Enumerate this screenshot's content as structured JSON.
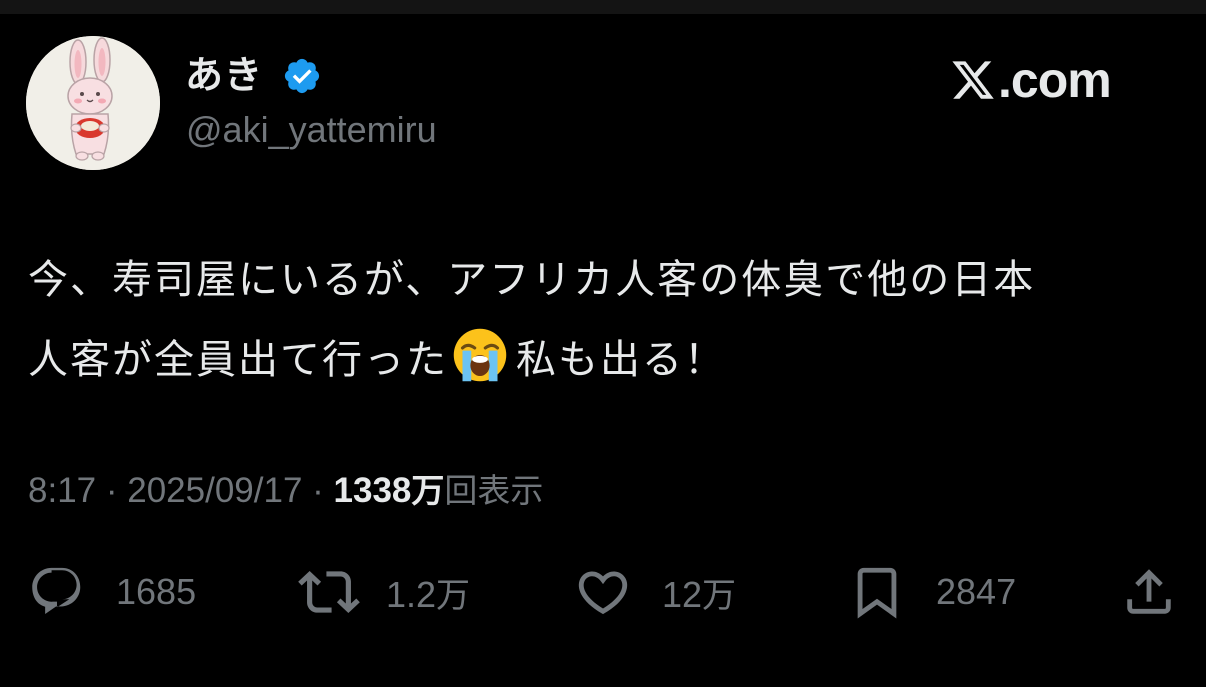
{
  "colors": {
    "background": "#000000",
    "primary_text": "#e7e9ea",
    "secondary_text": "#71767b",
    "verified_badge": "#1d9bf0"
  },
  "author": {
    "display_name": "あき",
    "handle": "@aki_yattemiru",
    "verified": true,
    "avatar_icon": "bunny-avatar-icon",
    "badge_icon": "verified-badge-icon"
  },
  "brand": {
    "text": ".com",
    "icon": "x-logo-icon"
  },
  "tweet": {
    "line1": "今、寿司屋にいるが、アフリカ人客の体臭で他の日本",
    "line2_before": "人客が全員出て行った",
    "emoji": "loudly-crying-face-icon",
    "line2_after": "私も出る！"
  },
  "meta": {
    "time": "8:17",
    "separator": " · ",
    "date": "2025/09/17",
    "views_count": "1338",
    "views_unit": "万",
    "views_label": "回表示"
  },
  "actions": {
    "reply": {
      "icon": "reply-icon",
      "count": "1685"
    },
    "repost": {
      "icon": "repost-icon",
      "count_num": "1.2",
      "count_unit": "万"
    },
    "like": {
      "icon": "heart-icon",
      "count_num": "12",
      "count_unit": "万"
    },
    "bookmark": {
      "icon": "bookmark-icon",
      "count": "2847"
    },
    "share": {
      "icon": "share-icon"
    }
  }
}
